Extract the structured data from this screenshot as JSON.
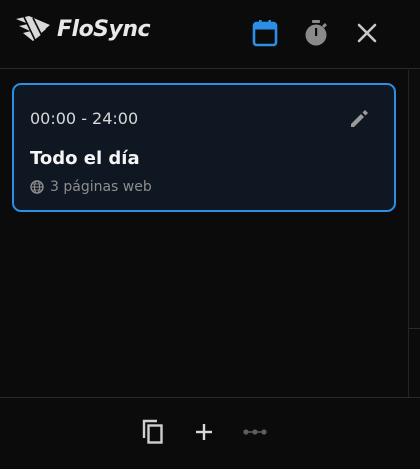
{
  "app": {
    "name": "FloSync"
  },
  "header": {
    "icons": {
      "calendar": "calendar-icon",
      "timer": "stopwatch-icon",
      "close": "close-icon"
    }
  },
  "card": {
    "time_range": "00:00 - 24:00",
    "title": "Todo el día",
    "subtitle": "3 páginas web",
    "selected": true
  },
  "footer": {
    "icons": {
      "copy": "copy-icon",
      "add": "plus-icon",
      "more": "more-icon"
    }
  },
  "colors": {
    "background": "#0b0b0b",
    "accent": "#2b8fe6",
    "card_bg": "#0f1822",
    "muted": "#8d8d8d"
  }
}
